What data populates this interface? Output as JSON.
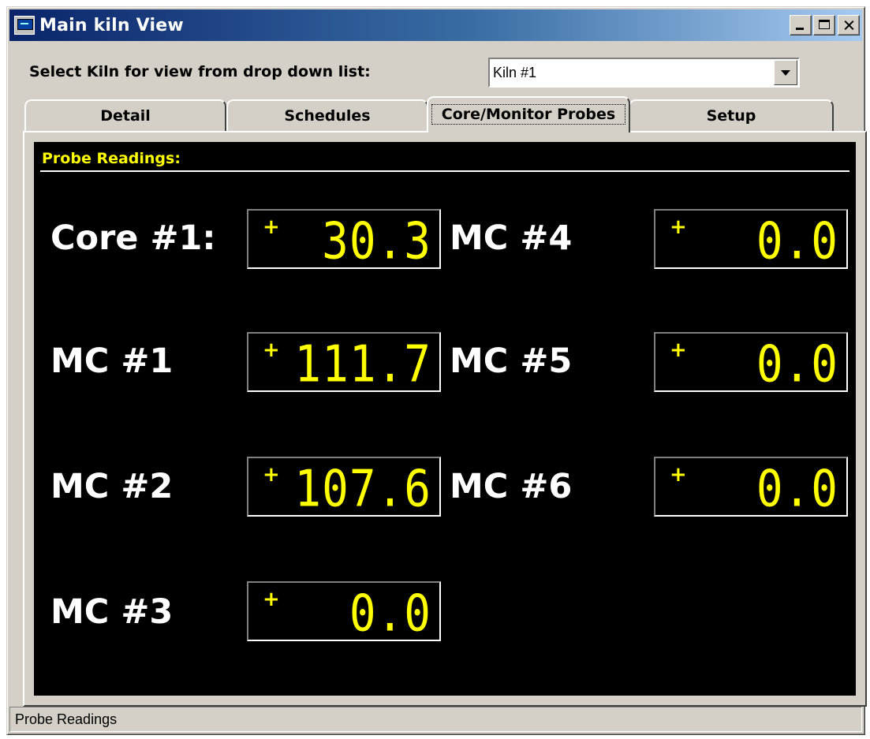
{
  "window": {
    "title": "Main kiln View"
  },
  "selector": {
    "label": "Select Kiln for view from drop down list:",
    "selected": "Kiln #1"
  },
  "tabs": [
    {
      "label": "Detail"
    },
    {
      "label": "Schedules"
    },
    {
      "label": "Core/Monitor Probes"
    },
    {
      "label": "Setup"
    }
  ],
  "active_tab": "Core/Monitor Probes",
  "panel": {
    "heading": "Probe Readings:",
    "probes": [
      {
        "label": "Core #1:",
        "sign": "+",
        "value": "30.3"
      },
      {
        "label": "MC #1",
        "sign": "+",
        "value": "111.7"
      },
      {
        "label": "MC #2",
        "sign": "+",
        "value": "107.6"
      },
      {
        "label": "MC #3",
        "sign": "+",
        "value": "0.0"
      },
      {
        "label": "MC #4",
        "sign": "+",
        "value": "0.0"
      },
      {
        "label": "MC #5",
        "sign": "+",
        "value": "0.0"
      },
      {
        "label": "MC #6",
        "sign": "+",
        "value": "0.0"
      }
    ]
  },
  "status": {
    "text": "Probe Readings"
  },
  "colors": {
    "display_text": "#ffff00",
    "panel_bg": "#000000",
    "title_bar": "#0a246a"
  }
}
